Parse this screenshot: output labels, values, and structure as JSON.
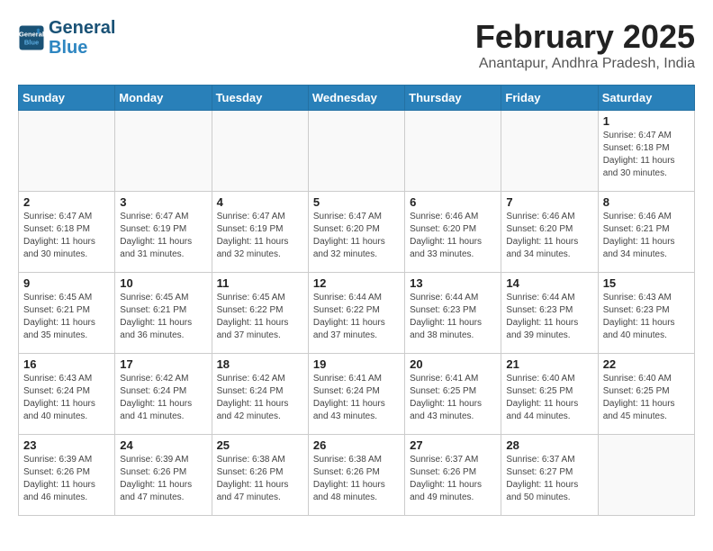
{
  "logo": {
    "line1": "General",
    "line2": "Blue"
  },
  "title": "February 2025",
  "subtitle": "Anantapur, Andhra Pradesh, India",
  "days_of_week": [
    "Sunday",
    "Monday",
    "Tuesday",
    "Wednesday",
    "Thursday",
    "Friday",
    "Saturday"
  ],
  "weeks": [
    [
      {
        "day": "",
        "info": ""
      },
      {
        "day": "",
        "info": ""
      },
      {
        "day": "",
        "info": ""
      },
      {
        "day": "",
        "info": ""
      },
      {
        "day": "",
        "info": ""
      },
      {
        "day": "",
        "info": ""
      },
      {
        "day": "1",
        "info": "Sunrise: 6:47 AM\nSunset: 6:18 PM\nDaylight: 11 hours and 30 minutes."
      }
    ],
    [
      {
        "day": "2",
        "info": "Sunrise: 6:47 AM\nSunset: 6:18 PM\nDaylight: 11 hours and 30 minutes."
      },
      {
        "day": "3",
        "info": "Sunrise: 6:47 AM\nSunset: 6:19 PM\nDaylight: 11 hours and 31 minutes."
      },
      {
        "day": "4",
        "info": "Sunrise: 6:47 AM\nSunset: 6:19 PM\nDaylight: 11 hours and 32 minutes."
      },
      {
        "day": "5",
        "info": "Sunrise: 6:47 AM\nSunset: 6:20 PM\nDaylight: 11 hours and 32 minutes."
      },
      {
        "day": "6",
        "info": "Sunrise: 6:46 AM\nSunset: 6:20 PM\nDaylight: 11 hours and 33 minutes."
      },
      {
        "day": "7",
        "info": "Sunrise: 6:46 AM\nSunset: 6:20 PM\nDaylight: 11 hours and 34 minutes."
      },
      {
        "day": "8",
        "info": "Sunrise: 6:46 AM\nSunset: 6:21 PM\nDaylight: 11 hours and 34 minutes."
      }
    ],
    [
      {
        "day": "9",
        "info": "Sunrise: 6:45 AM\nSunset: 6:21 PM\nDaylight: 11 hours and 35 minutes."
      },
      {
        "day": "10",
        "info": "Sunrise: 6:45 AM\nSunset: 6:21 PM\nDaylight: 11 hours and 36 minutes."
      },
      {
        "day": "11",
        "info": "Sunrise: 6:45 AM\nSunset: 6:22 PM\nDaylight: 11 hours and 37 minutes."
      },
      {
        "day": "12",
        "info": "Sunrise: 6:44 AM\nSunset: 6:22 PM\nDaylight: 11 hours and 37 minutes."
      },
      {
        "day": "13",
        "info": "Sunrise: 6:44 AM\nSunset: 6:23 PM\nDaylight: 11 hours and 38 minutes."
      },
      {
        "day": "14",
        "info": "Sunrise: 6:44 AM\nSunset: 6:23 PM\nDaylight: 11 hours and 39 minutes."
      },
      {
        "day": "15",
        "info": "Sunrise: 6:43 AM\nSunset: 6:23 PM\nDaylight: 11 hours and 40 minutes."
      }
    ],
    [
      {
        "day": "16",
        "info": "Sunrise: 6:43 AM\nSunset: 6:24 PM\nDaylight: 11 hours and 40 minutes."
      },
      {
        "day": "17",
        "info": "Sunrise: 6:42 AM\nSunset: 6:24 PM\nDaylight: 11 hours and 41 minutes."
      },
      {
        "day": "18",
        "info": "Sunrise: 6:42 AM\nSunset: 6:24 PM\nDaylight: 11 hours and 42 minutes."
      },
      {
        "day": "19",
        "info": "Sunrise: 6:41 AM\nSunset: 6:24 PM\nDaylight: 11 hours and 43 minutes."
      },
      {
        "day": "20",
        "info": "Sunrise: 6:41 AM\nSunset: 6:25 PM\nDaylight: 11 hours and 43 minutes."
      },
      {
        "day": "21",
        "info": "Sunrise: 6:40 AM\nSunset: 6:25 PM\nDaylight: 11 hours and 44 minutes."
      },
      {
        "day": "22",
        "info": "Sunrise: 6:40 AM\nSunset: 6:25 PM\nDaylight: 11 hours and 45 minutes."
      }
    ],
    [
      {
        "day": "23",
        "info": "Sunrise: 6:39 AM\nSunset: 6:26 PM\nDaylight: 11 hours and 46 minutes."
      },
      {
        "day": "24",
        "info": "Sunrise: 6:39 AM\nSunset: 6:26 PM\nDaylight: 11 hours and 47 minutes."
      },
      {
        "day": "25",
        "info": "Sunrise: 6:38 AM\nSunset: 6:26 PM\nDaylight: 11 hours and 47 minutes."
      },
      {
        "day": "26",
        "info": "Sunrise: 6:38 AM\nSunset: 6:26 PM\nDaylight: 11 hours and 48 minutes."
      },
      {
        "day": "27",
        "info": "Sunrise: 6:37 AM\nSunset: 6:26 PM\nDaylight: 11 hours and 49 minutes."
      },
      {
        "day": "28",
        "info": "Sunrise: 6:37 AM\nSunset: 6:27 PM\nDaylight: 11 hours and 50 minutes."
      },
      {
        "day": "",
        "info": ""
      }
    ]
  ]
}
